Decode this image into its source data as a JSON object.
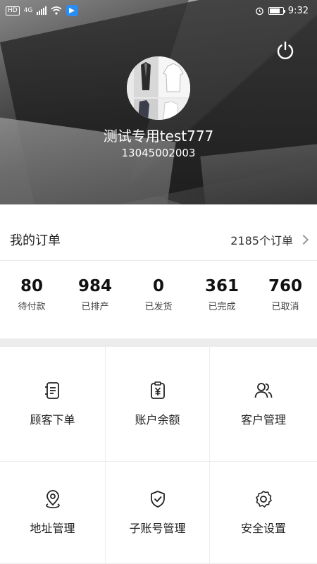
{
  "status_bar": {
    "network_chip": "HD",
    "network_type": "4G",
    "time": "9:32",
    "battery_level": 0.8,
    "icons": [
      "signal-icon",
      "wifi-icon",
      "app-notification-icon",
      "alarm-icon",
      "battery-icon"
    ]
  },
  "profile": {
    "name": "测试专用test777",
    "phone": "13045002003",
    "power_icon": "power-icon"
  },
  "orders": {
    "title": "我的订单",
    "total": "2185个订单"
  },
  "stats": [
    {
      "value": "80",
      "label": "待付款"
    },
    {
      "value": "984",
      "label": "已排产"
    },
    {
      "value": "0",
      "label": "已发货"
    },
    {
      "value": "361",
      "label": "已完成"
    },
    {
      "value": "760",
      "label": "已取消"
    }
  ],
  "menu": [
    {
      "label": "顾客下单",
      "icon": "order-list-icon"
    },
    {
      "label": "账户余额",
      "icon": "balance-yen-icon"
    },
    {
      "label": "客户管理",
      "icon": "users-icon"
    },
    {
      "label": "地址管理",
      "icon": "location-pin-icon"
    },
    {
      "label": "子账号管理",
      "icon": "shield-check-icon"
    },
    {
      "label": "安全设置",
      "icon": "gear-icon"
    }
  ],
  "colors": {
    "app_icon": "#2b8cf3",
    "divider": "#ececec",
    "text": "#222222"
  }
}
